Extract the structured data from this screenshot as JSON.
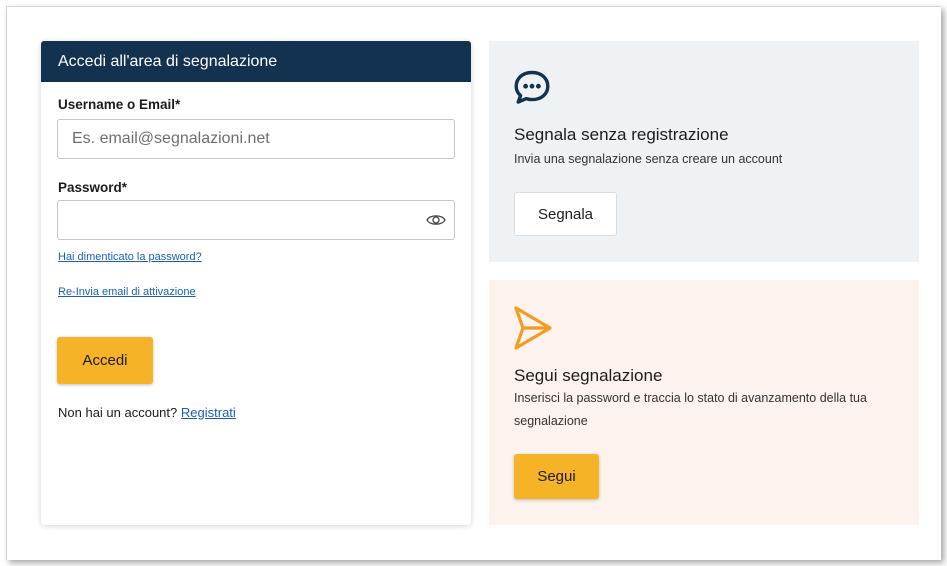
{
  "login": {
    "title": "Accedi all'area di segnalazione",
    "username_label": "Username o Email*",
    "username_placeholder": "Es. email@segnalazioni.net",
    "password_label": "Password*",
    "password_value": "",
    "forgot_link": "Hai dimenticato la password?",
    "resend_link": "Re-Invia email di attivazione",
    "submit_label": "Accedi",
    "no_account_text": "Non hai un account?",
    "register_link": "Registrati"
  },
  "report": {
    "icon": "chat-bubble-icon",
    "title": "Segnala senza registrazione",
    "description": "Invia una segnalazione senza creare un account",
    "button_label": "Segnala"
  },
  "follow": {
    "icon": "send-icon",
    "title": "Segui segnalazione",
    "description": "Inserisci la password e traccia lo stato di avanzamento della tua segnalazione",
    "button_label": "Segui"
  },
  "colors": {
    "header_navy": "#12324f",
    "accent_yellow": "#f5b327",
    "link_blue": "#1a5fb4",
    "panel_blue_bg": "#eef2f5",
    "panel_peach_bg": "#fdf3ee",
    "send_icon_orange": "#f39c1f"
  }
}
